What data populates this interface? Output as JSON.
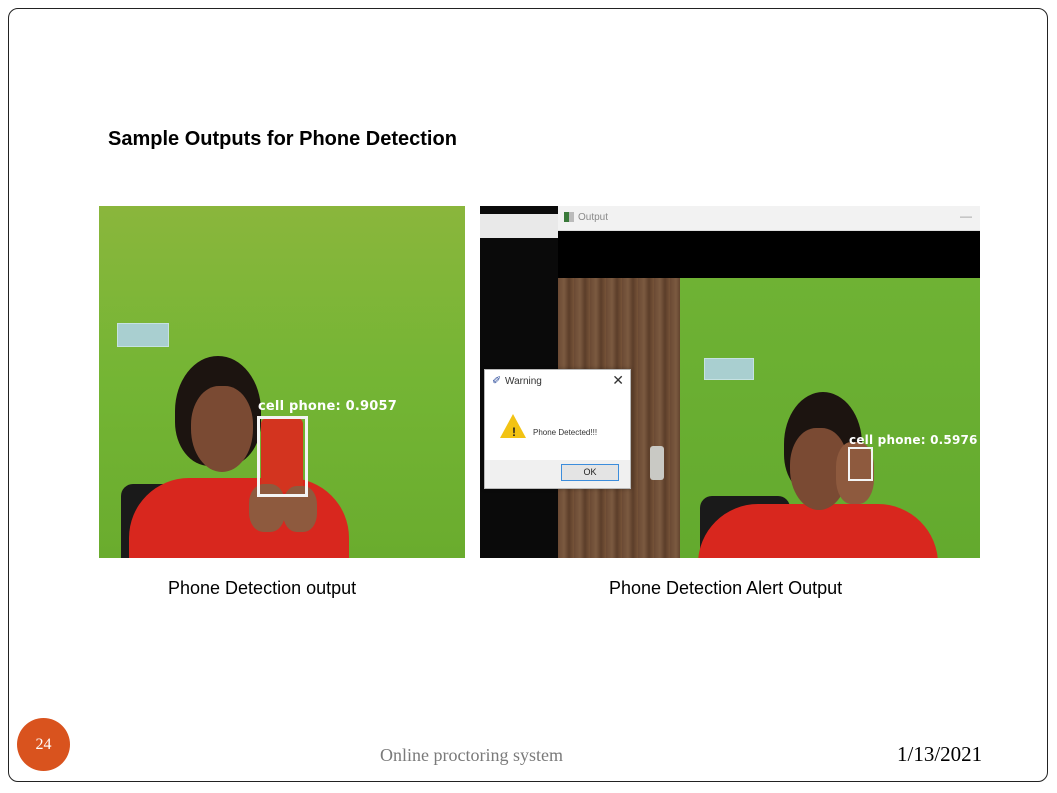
{
  "slide": {
    "title": "Sample Outputs for Phone Detection",
    "captions": {
      "left": "Phone Detection output",
      "right": "Phone Detection Alert Output"
    },
    "footer": {
      "text": "Online proctoring system",
      "date": "1/13/2021",
      "page_number": "24"
    },
    "accent_color": "#d9531e"
  },
  "image_left": {
    "detection_label": "cell phone: 0.9057"
  },
  "image_right": {
    "window_title": "Output",
    "detection_label": "cell phone: 0.5976",
    "dialog": {
      "title": "Warning",
      "message": "Phone Detected!!!",
      "ok_label": "OK",
      "close_symbol": "✕",
      "icon": "warning-triangle-icon"
    }
  }
}
